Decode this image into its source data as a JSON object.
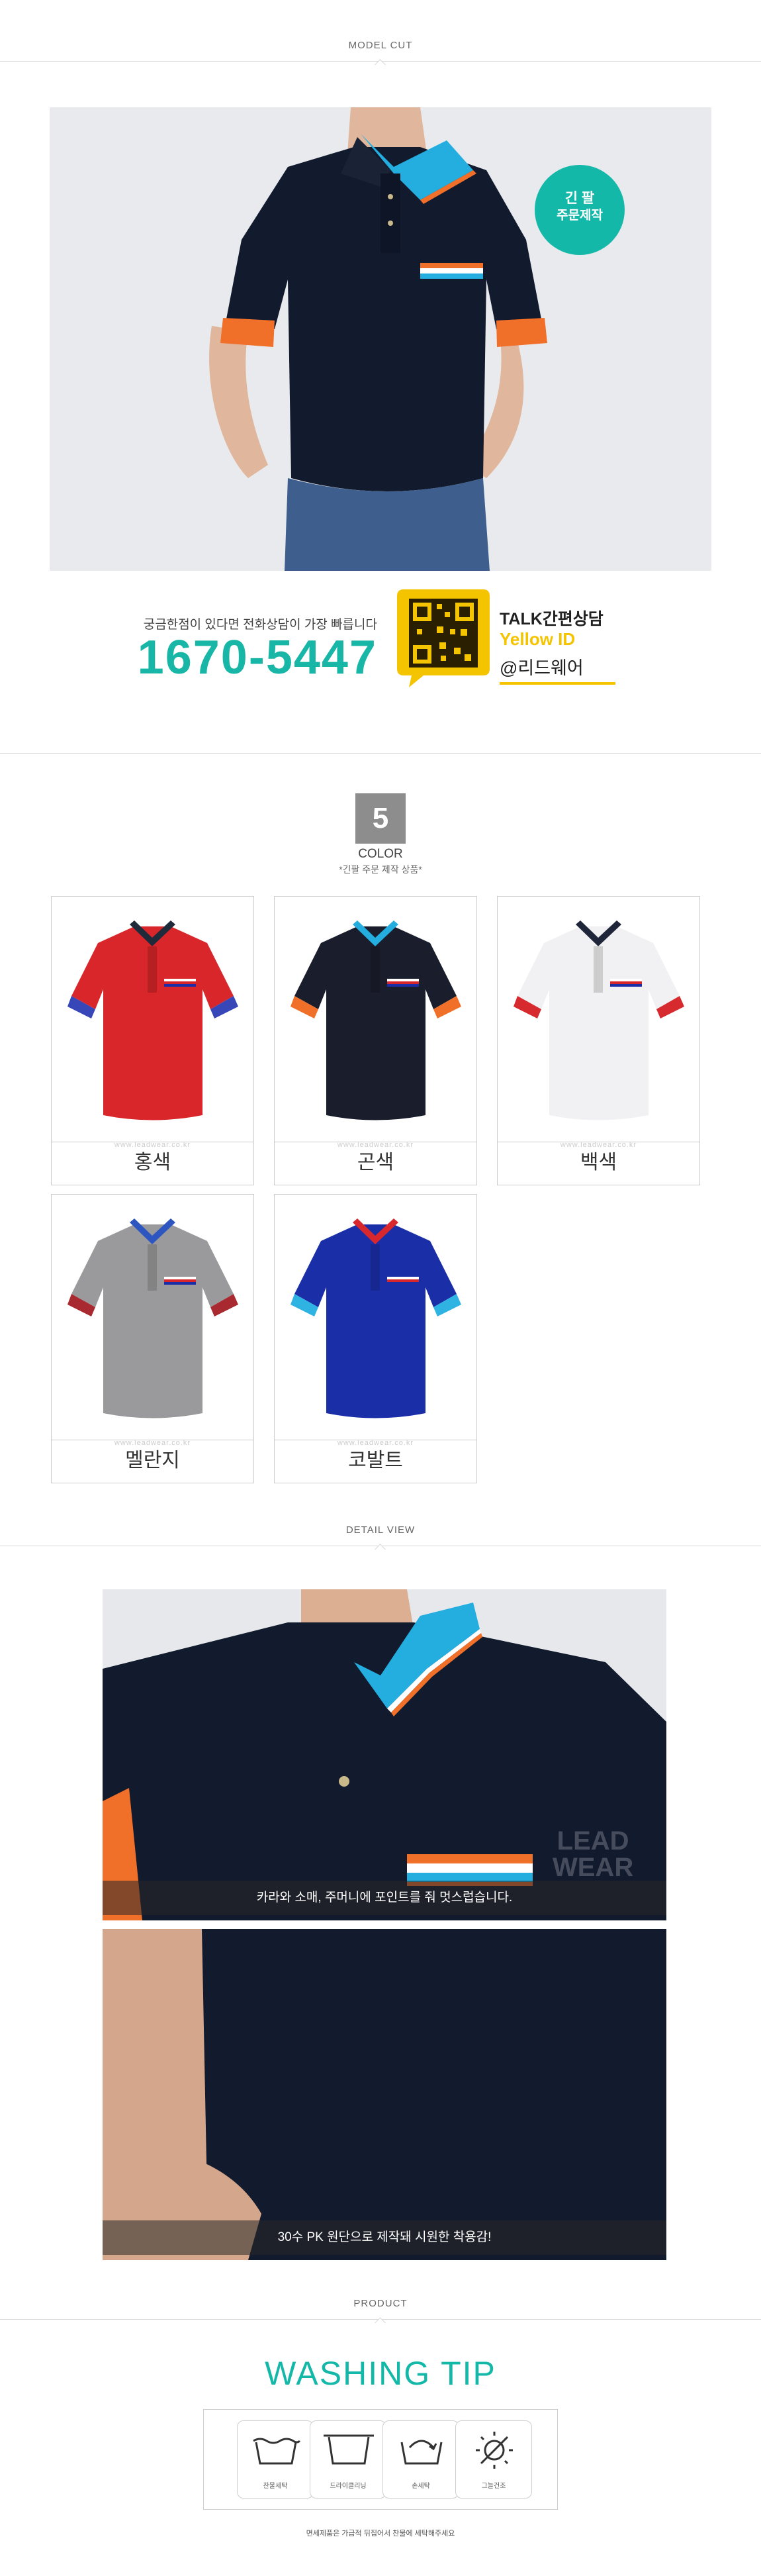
{
  "sections": {
    "model_cut": "MODEL CUT",
    "detail_view": "DETAIL VIEW",
    "product": "PRODUCT"
  },
  "model": {
    "badge_line1": "긴 팔",
    "badge_line2": "주문제작"
  },
  "contact": {
    "notice": "궁금한점이 있다면 전화상담이 가장 빠릅니다",
    "phone": "1670-5447",
    "talk_label": "TALK",
    "talk_title": "간편상담",
    "yellow_id": "Yellow ID",
    "kakao_id": "@리드웨어"
  },
  "colors": {
    "count": "5",
    "title": "COLOR",
    "subtitle": "*긴팔 주문 제작 상품*",
    "watermark": "www.leadwear.co.kr",
    "items": [
      {
        "name": "홍색",
        "body": "#d8262a",
        "collar": "#1f2a3a",
        "sleeve": "#3747b8"
      },
      {
        "name": "곤색",
        "body": "#1a1d2c",
        "collar": "#24aee0",
        "sleeve": "#f0702a"
      },
      {
        "name": "백색",
        "body": "#f1f1f3",
        "collar": "#20263a",
        "sleeve": "#d62a2e"
      },
      {
        "name": "멜란지",
        "body": "#9a9a9c",
        "collar": "#2e56c0",
        "sleeve": "#a82a30"
      },
      {
        "name": "코발트",
        "body": "#1a2ea8",
        "collar": "#d8272d",
        "sleeve": "#2fb3e3"
      }
    ]
  },
  "detail": {
    "caption1": "카라와 소매, 주머니에 포인트를 줘 멋스럽습니다.",
    "caption2": "30수 PK 원단으로 제작돼 시원한 착용감!",
    "brand_watermark_1": "LEAD",
    "brand_watermark_2": "WEAR"
  },
  "washing": {
    "title": "WASHING TIP",
    "icons": [
      {
        "label": "찬물세탁",
        "icon": "wash-tub-icon"
      },
      {
        "label": "드라이클리닝",
        "icon": "dry-clean-icon"
      },
      {
        "label": "손세탁",
        "icon": "hand-wash-icon"
      },
      {
        "label": "그늘건조",
        "icon": "shade-dry-icon"
      }
    ],
    "note": "면세제품은 가급적 뒤집어서 찬물에 세탁해주세요"
  },
  "theme": {
    "accent": "#14b8a8",
    "phone_color": "#17b6a6",
    "kakao_yellow": "#f4c400"
  }
}
